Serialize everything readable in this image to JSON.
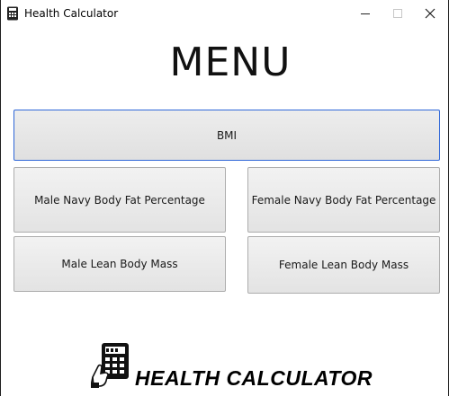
{
  "window": {
    "title": "Health Calculator",
    "controls": {
      "minimize": "minimize",
      "maximize": "maximize",
      "close": "close"
    }
  },
  "menu": {
    "heading": "MENU",
    "buttons": {
      "bmi": "BMI",
      "male_navy": "Male Navy Body Fat Percentage",
      "female_navy": "Female Navy Body Fat Percentage",
      "male_lean": "Male Lean Body Mass",
      "female_lean": "Female Lean Body Mass"
    }
  },
  "logo": {
    "text": "HEALTH CALCULATOR",
    "icon": "calculator-hand-icon"
  },
  "colors": {
    "focus_border": "#2f67d8",
    "button_border": "#adadad",
    "background": "#ffffff"
  }
}
